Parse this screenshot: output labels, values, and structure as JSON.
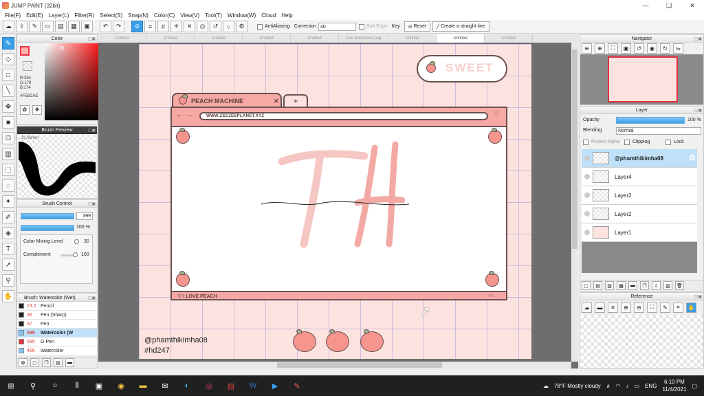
{
  "window": {
    "title": "JUMP PAINT (32bit)",
    "controls": [
      "—",
      "❑",
      "✕"
    ]
  },
  "menu": [
    "File(F)",
    "Edit(E)",
    "Layer(L)",
    "Filter(R)",
    "Select(S)",
    "Snap(N)",
    "Color(C)",
    "View(V)",
    "Tool(T)",
    "Window(W)",
    "Cloud",
    "Help"
  ],
  "toolbar": {
    "antialiasing": "AntiAliasing",
    "correction_label": "Correction",
    "correction_value": "40",
    "soft_edge": "Soft Edge",
    "key_label": "Key",
    "reset": "Reset",
    "straight_line": "Create a straight line"
  },
  "color_panel": {
    "title": "Color",
    "r": "R:254",
    "g": "G:178",
    "b": "B:174",
    "hex": "#FEB2AE",
    "fg_color": "#feb2ae"
  },
  "brush_preview": {
    "title": "Brush Preview",
    "size_label": "20.98mm"
  },
  "brush_control": {
    "title": "Brush Control",
    "size_value": "399",
    "opacity_value": "100 %",
    "color_mixing_label": "Color Mixing Level",
    "color_mixing_value": "30",
    "complement_label": "Complement",
    "complement_value": "100"
  },
  "brush_list": {
    "title": "Brush: Watercolor (Wet)",
    "items": [
      {
        "size": "13.2",
        "name": "Pencil",
        "color": "#222222"
      },
      {
        "size": "36",
        "name": "Pen (Sharp)",
        "color": "#222222"
      },
      {
        "size": "37",
        "name": "Pen",
        "color": "#222222"
      },
      {
        "size": "399",
        "name": "Watercolor (W",
        "color": "#7fc4f4"
      },
      {
        "size": "595",
        "name": "G Pen",
        "color": "#e03040"
      },
      {
        "size": "466",
        "name": "Watercolor",
        "color": "#7fc4f4"
      }
    ]
  },
  "tabs": [
    "Untitled",
    "Untitled",
    "Untitled",
    "Untitled",
    "Untitled",
    "Line Illustration.png",
    "Untitled",
    "Untitled",
    "Untitled"
  ],
  "artwork": {
    "tab_title": "PEACH MACHINE",
    "tab_close": "✕",
    "new_tab": "+",
    "url": "WWW.ZEEZEEPLANET.XYZ",
    "sweet": "SWEET",
    "footer": "♡ I LOVE PEACH",
    "footer_right": "○○",
    "handle": "@phamthikimha08",
    "tag": "#hd247"
  },
  "navigator": {
    "title": "Navigator"
  },
  "layer_panel": {
    "title": "Layer",
    "opacity_label": "Opacity",
    "opacity_value": "100 %",
    "blending_label": "Blending",
    "blending_value": "Normal",
    "protect_alpha": "Protect Alpha",
    "clipping": "Clipping",
    "lock": "Lock",
    "layers": [
      {
        "name": "@phamthikimha08",
        "selected": true
      },
      {
        "name": "Layer4",
        "selected": false
      },
      {
        "name": "Layer2",
        "selected": false
      },
      {
        "name": "Layer2",
        "selected": false
      },
      {
        "name": "Layer1",
        "selected": false
      }
    ]
  },
  "reference": {
    "title": "Reference"
  },
  "taskbar": {
    "weather": "78°F  Mostly cloudy",
    "lang": "ENG",
    "time": "6:10 PM",
    "date": "11/4/2021"
  }
}
